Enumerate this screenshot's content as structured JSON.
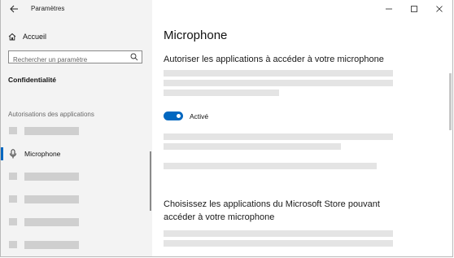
{
  "window": {
    "title": "Paramètres"
  },
  "sidebar": {
    "home_label": "Accueil",
    "search_placeholder": "Rechercher un paramètre",
    "category": "Confidentialité",
    "section_label": "Autorisations des applications",
    "items": [
      {
        "label": "",
        "placeholder": true
      },
      {
        "label": "Microphone",
        "icon": "microphone-icon",
        "selected": true
      },
      {
        "label": "",
        "placeholder": true
      },
      {
        "label": "",
        "placeholder": true
      },
      {
        "label": "",
        "placeholder": true
      },
      {
        "label": "",
        "placeholder": true
      }
    ]
  },
  "main": {
    "page_title": "Microphone",
    "section1_heading": "Autoriser les applications à accéder à votre microphone",
    "toggle": {
      "label": "Activé",
      "on": true
    },
    "section2_heading_line1": "Choisissez les applications du Microsoft Store pouvant",
    "section2_heading_line2": "accéder à votre microphone"
  },
  "colors": {
    "accent": "#0067c0",
    "sidebar_bg": "#f3f3f3",
    "placeholder_bar": "#e4e4e4"
  },
  "icons": [
    "back-arrow-icon",
    "minimize-icon",
    "maximize-icon",
    "close-icon",
    "home-icon",
    "search-icon",
    "microphone-icon"
  ]
}
